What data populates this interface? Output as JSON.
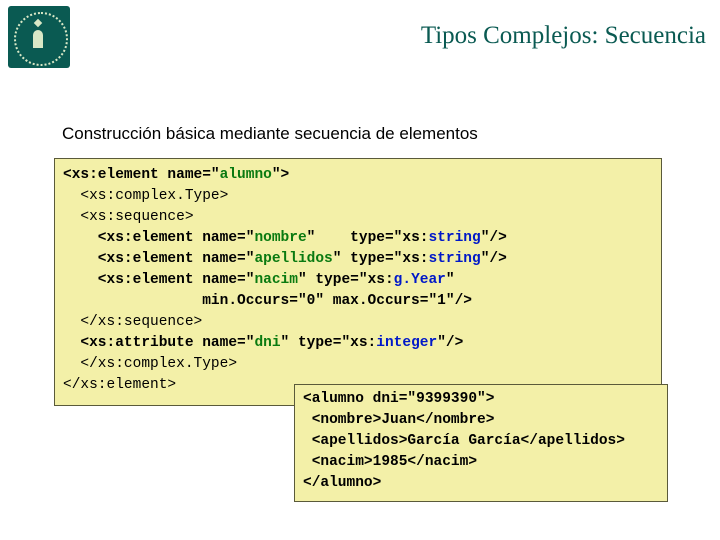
{
  "title": "Tipos Complejos: Secuencia",
  "subtitle": "Construcción básica mediante secuencia de elementos",
  "schema": {
    "l1a": "<xs:element name=\"",
    "l1b": "alumno",
    "l1c": "\">",
    "l2": "  <xs:complex.Type>",
    "l3": "  <xs:sequence>",
    "l4a": "    <xs:element name=\"",
    "l4b": "nombre",
    "l4c": "\"    type=\"xs:",
    "l4d": "string",
    "l4e": "\"/>",
    "l5a": "    <xs:element name=\"",
    "l5b": "apellidos",
    "l5c": "\" type=\"xs:",
    "l5d": "string",
    "l5e": "\"/>",
    "l6a": "    <xs:element name=\"",
    "l6b": "nacim",
    "l6c": "\" type=\"xs:",
    "l6d": "g.Year",
    "l6e": "\"",
    "l7": "                min.Occurs=\"0\" max.Occurs=\"1\"/>",
    "l8": "  </xs:sequence>",
    "l9a": "  <xs:attribute name=\"",
    "l9b": "dni",
    "l9c": "\" type=\"xs:",
    "l9d": "integer",
    "l9e": "\"/>",
    "l10": "  </xs:complex.Type>",
    "l11": "</xs:element>"
  },
  "instance": {
    "l1": "<alumno dni=\"9399390\">",
    "l2": " <nombre>Juan</nombre>",
    "l3": " <apellidos>García García</apellidos>",
    "l4": " <nacim>1985</nacim>",
    "l5": "</alumno>"
  }
}
